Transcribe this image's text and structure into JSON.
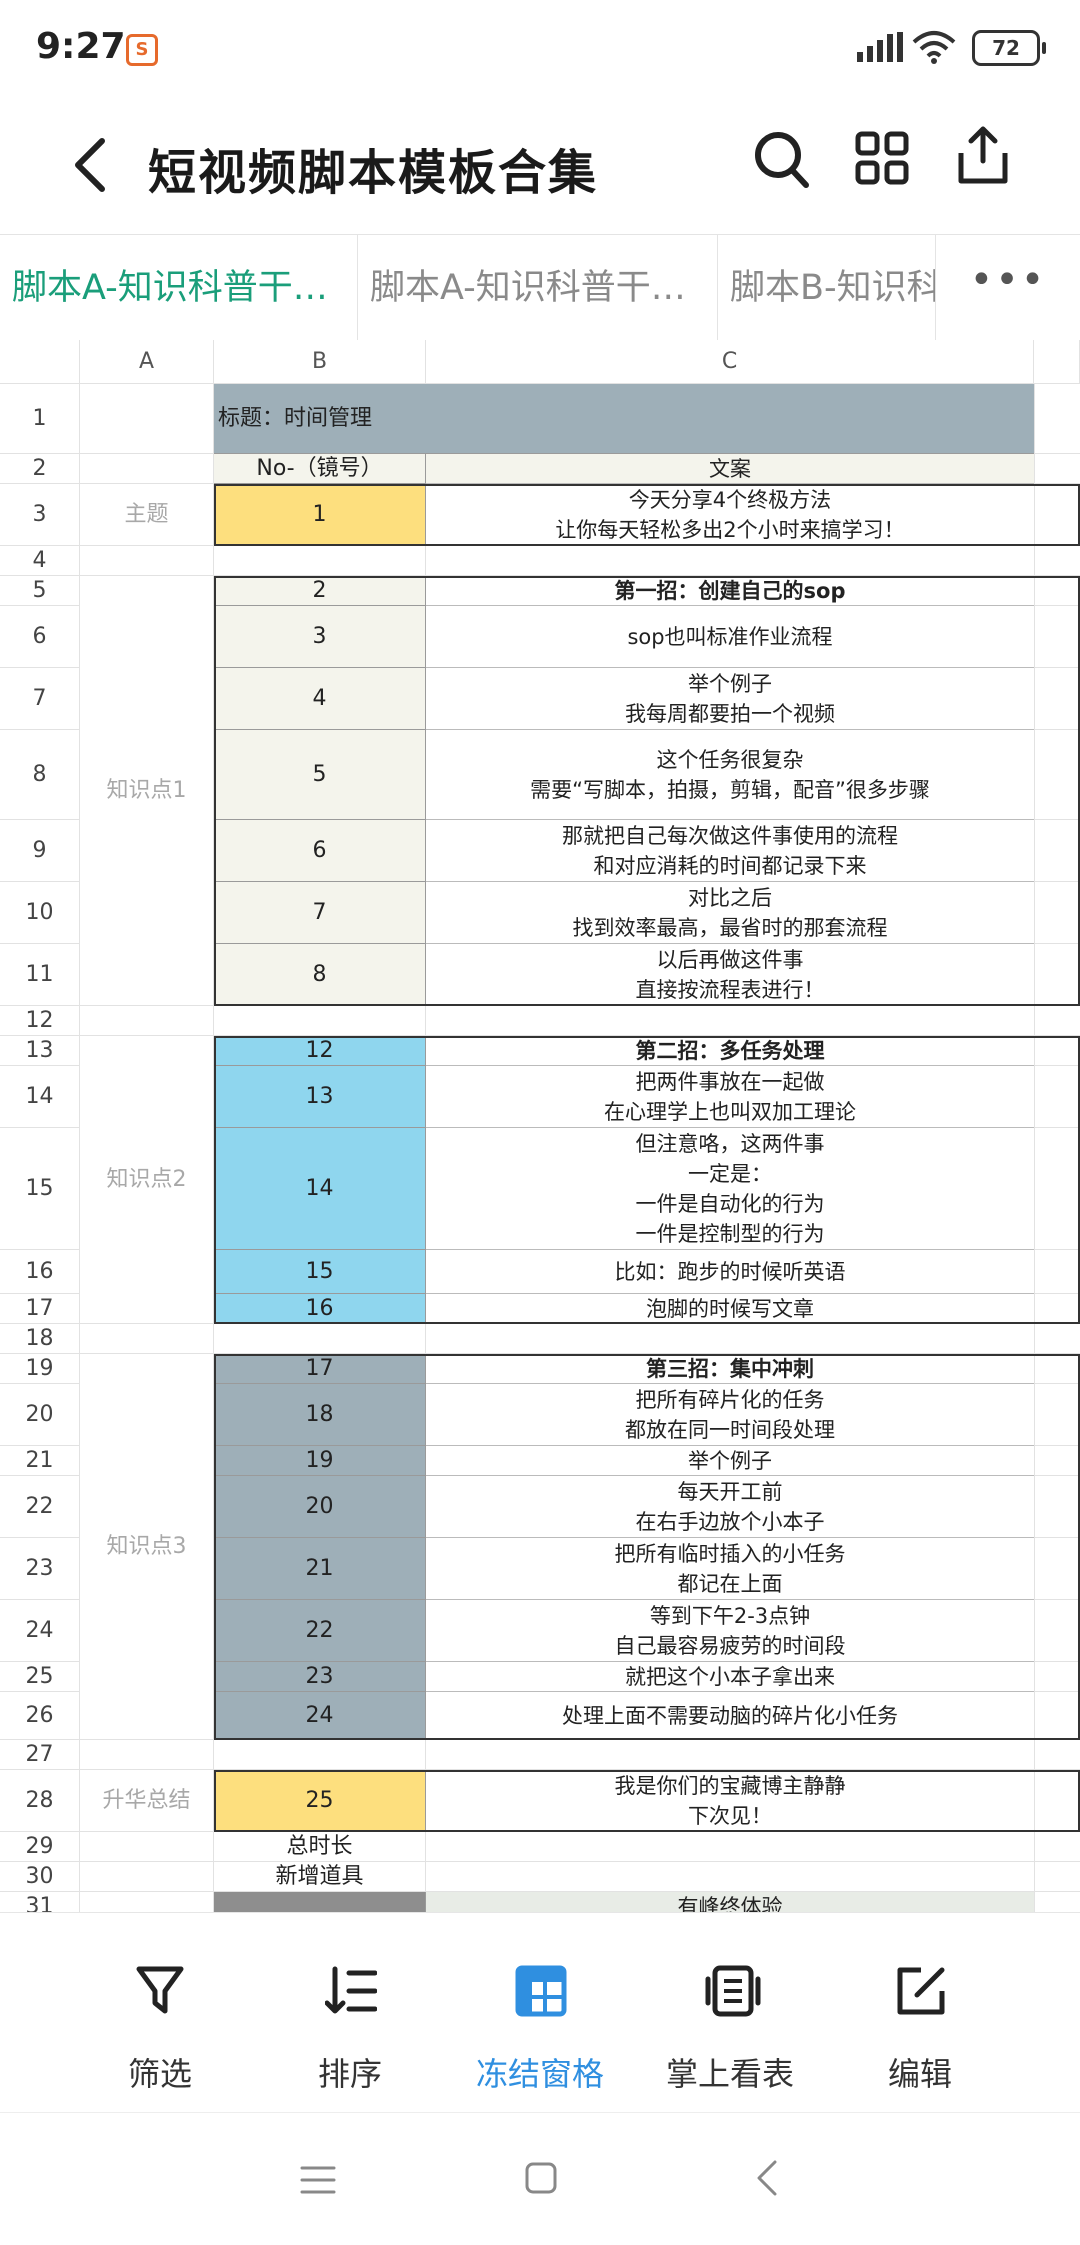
{
  "status": {
    "time": "9:27",
    "app_badge": "S",
    "battery": "72"
  },
  "titlebar": {
    "title": "短视频脚本模板合集"
  },
  "tabs": [
    {
      "label": "脚本A-知识科普干…",
      "active": true
    },
    {
      "label": "脚本A-知识科普干…",
      "active": false
    },
    {
      "label": "脚本B-知识科",
      "active": false
    }
  ],
  "tabs_more": "•••",
  "columns": [
    "A",
    "B",
    "C"
  ],
  "rows": [
    {
      "n": "1",
      "h": 70
    },
    {
      "n": "2",
      "h": 30
    },
    {
      "n": "3",
      "h": 62
    },
    {
      "n": "4",
      "h": 30
    },
    {
      "n": "5",
      "h": 30
    },
    {
      "n": "6",
      "h": 62
    },
    {
      "n": "7",
      "h": 62
    },
    {
      "n": "8",
      "h": 90
    },
    {
      "n": "9",
      "h": 62
    },
    {
      "n": "10",
      "h": 62
    },
    {
      "n": "11",
      "h": 62
    },
    {
      "n": "12",
      "h": 30
    },
    {
      "n": "13",
      "h": 30
    },
    {
      "n": "14",
      "h": 62
    },
    {
      "n": "15",
      "h": 122
    },
    {
      "n": "16",
      "h": 44
    },
    {
      "n": "17",
      "h": 30
    },
    {
      "n": "18",
      "h": 30
    },
    {
      "n": "19",
      "h": 30
    },
    {
      "n": "20",
      "h": 62
    },
    {
      "n": "21",
      "h": 30
    },
    {
      "n": "22",
      "h": 62
    },
    {
      "n": "23",
      "h": 62
    },
    {
      "n": "24",
      "h": 62
    },
    {
      "n": "25",
      "h": 30
    },
    {
      "n": "26",
      "h": 48
    },
    {
      "n": "27",
      "h": 30
    },
    {
      "n": "28",
      "h": 62
    },
    {
      "n": "29",
      "h": 30
    },
    {
      "n": "30",
      "h": 30
    },
    {
      "n": "31",
      "h": 30
    }
  ],
  "title_cell": "标题：时间管理",
  "header_b": "No-（镜号）",
  "header_c": "文案",
  "sections": [
    {
      "label": "主题",
      "from": 3,
      "to": 3
    },
    {
      "label": "知识点1",
      "from": 5,
      "to": 11
    },
    {
      "label": "知识点2",
      "from": 13,
      "to": 17
    },
    {
      "label": "知识点3",
      "from": 19,
      "to": 26
    },
    {
      "label": "升华总结",
      "from": 28,
      "to": 28
    }
  ],
  "entries": [
    {
      "row": 3,
      "no": "1",
      "text": "今天分享4个终极方法\n让你每天轻松多出2个小时来搞学习！",
      "bold": false,
      "color": "#fddf7e"
    },
    {
      "row": 5,
      "no": "2",
      "text": "第一招：创建自己的sop",
      "bold": true,
      "color": "#f4f4ec"
    },
    {
      "row": 6,
      "no": "3",
      "text": "sop也叫标准作业流程",
      "bold": false,
      "color": "#f4f4ec"
    },
    {
      "row": 7,
      "no": "4",
      "text": "举个例子\n我每周都要拍一个视频",
      "bold": false,
      "color": "#f4f4ec"
    },
    {
      "row": 8,
      "no": "5",
      "text": "这个任务很复杂\n需要“写脚本，拍摄，剪辑，配音”很多步骤",
      "bold": false,
      "color": "#f4f4ec"
    },
    {
      "row": 9,
      "no": "6",
      "text": "那就把自己每次做这件事使用的流程\n和对应消耗的时间都记录下来",
      "bold": false,
      "color": "#f4f4ec"
    },
    {
      "row": 10,
      "no": "7",
      "text": "对比之后\n找到效率最高，最省时的那套流程",
      "bold": false,
      "color": "#f4f4ec"
    },
    {
      "row": 11,
      "no": "8",
      "text": "以后再做这件事\n直接按流程表进行！",
      "bold": false,
      "color": "#f4f4ec"
    },
    {
      "row": 13,
      "no": "12",
      "text": "第二招：多任务处理",
      "bold": true,
      "color": "#8fd6ee"
    },
    {
      "row": 14,
      "no": "13",
      "text": "把两件事放在一起做\n在心理学上也叫双加工理论",
      "bold": false,
      "color": "#8fd6ee"
    },
    {
      "row": 15,
      "no": "14",
      "text": "但注意咯，这两件事\n一定是：\n一件是自动化的行为\n一件是控制型的行为",
      "bold": false,
      "color": "#8fd6ee"
    },
    {
      "row": 16,
      "no": "15",
      "text": "比如：跑步的时候听英语",
      "bold": false,
      "color": "#8fd6ee"
    },
    {
      "row": 17,
      "no": "16",
      "text": "泡脚的时候写文章",
      "bold": false,
      "color": "#8fd6ee"
    },
    {
      "row": 19,
      "no": "17",
      "text": "第三招：集中冲刺",
      "bold": true,
      "color": "#9eafb8"
    },
    {
      "row": 20,
      "no": "18",
      "text": "把所有碎片化的任务\n都放在同一时间段处理",
      "bold": false,
      "color": "#9eafb8"
    },
    {
      "row": 21,
      "no": "19",
      "text": "举个例子",
      "bold": false,
      "color": "#9eafb8"
    },
    {
      "row": 22,
      "no": "20",
      "text": "每天开工前\n在右手边放个小本子",
      "bold": false,
      "color": "#9eafb8"
    },
    {
      "row": 23,
      "no": "21",
      "text": "把所有临时插入的小任务\n都记在上面",
      "bold": false,
      "color": "#9eafb8"
    },
    {
      "row": 24,
      "no": "22",
      "text": "等到下午2-3点钟\n自己最容易疲劳的时间段",
      "bold": false,
      "color": "#9eafb8"
    },
    {
      "row": 25,
      "no": "23",
      "text": "就把这个小本子拿出来",
      "bold": false,
      "color": "#9eafb8"
    },
    {
      "row": 26,
      "no": "24",
      "text": "处理上面不需要动脑的碎片化小任务",
      "bold": false,
      "color": "#9eafb8"
    },
    {
      "row": 28,
      "no": "25",
      "text": "我是你们的宝藏博主静静\n下次见！",
      "bold": false,
      "color": "#fddf7e"
    }
  ],
  "extra_rows": [
    {
      "row": 29,
      "b": "总时长"
    },
    {
      "row": 30,
      "b": "新增道具"
    }
  ],
  "row31": {
    "text": "有峰终体验"
  },
  "colors": {
    "accent_green": "#1a9e7a",
    "accent_blue": "#2f8fe0",
    "title_fill": "#9eafb8"
  },
  "toolbar": [
    {
      "label": "筛选",
      "icon": "filter-icon",
      "active": false
    },
    {
      "label": "排序",
      "icon": "sort-icon",
      "active": false
    },
    {
      "label": "冻结窗格",
      "icon": "freeze-panes-icon",
      "active": true
    },
    {
      "label": "掌上看表",
      "icon": "mobile-view-icon",
      "active": false
    },
    {
      "label": "编辑",
      "icon": "edit-icon",
      "active": false
    }
  ]
}
